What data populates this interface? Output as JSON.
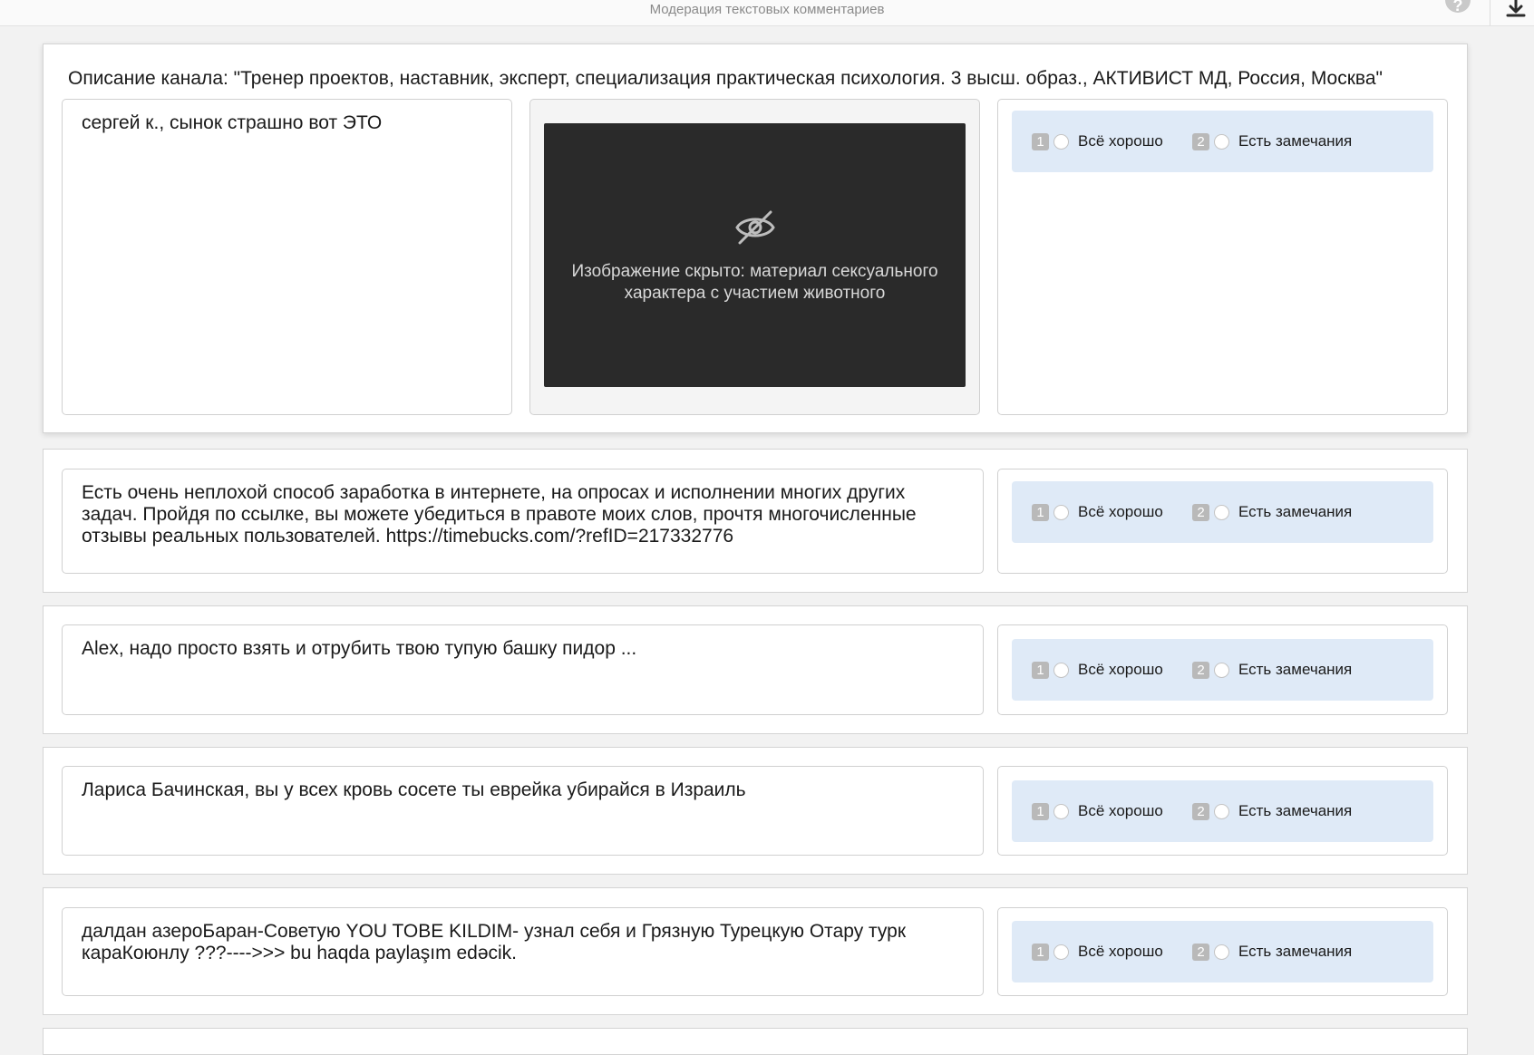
{
  "header": {
    "title": "Модерация текстовых комментариев",
    "help_icon": "?",
    "download_icon": "download-icon"
  },
  "options": {
    "ok": {
      "key": "1",
      "label": "Всё хорошо"
    },
    "issues": {
      "key": "2",
      "label": "Есть замечания"
    }
  },
  "channel": {
    "description": "Описание канала: \"Тренер проектов, наставник, эксперт, специализация практическая психология. 3 высш. образ., АКТИВИСТ МД, Россия, Москва\""
  },
  "media": {
    "hidden_label": "Изображение скрыто: материал сексуального характера с участием животного"
  },
  "comments": [
    {
      "text": "сергей к., сынок страшно вот ЭТО"
    },
    {
      "text": "Есть очень неплохой способ заработка в интернете, на опросах и исполнении многих других задач. Пройдя по ссылке, вы можете убедиться в правоте моих слов, прочтя многочисленные отзывы реальных пользователей. https://timebucks.com/?refID=217332776"
    },
    {
      "text": "Alex, надо просто взять и отрубить твою тупую башку пидор ..."
    },
    {
      "text": "Лариса Бачинская, вы у всех кровь сосете ты еврейка убирайся в Израиль"
    },
    {
      "text": "далдан азероБаран-Советую YOU TOBE KILDIM- узнал себя и Грязную Турецкую Отару турк караКоюнлу ???---->>> bu haqda paylaşım edəcik."
    }
  ]
}
